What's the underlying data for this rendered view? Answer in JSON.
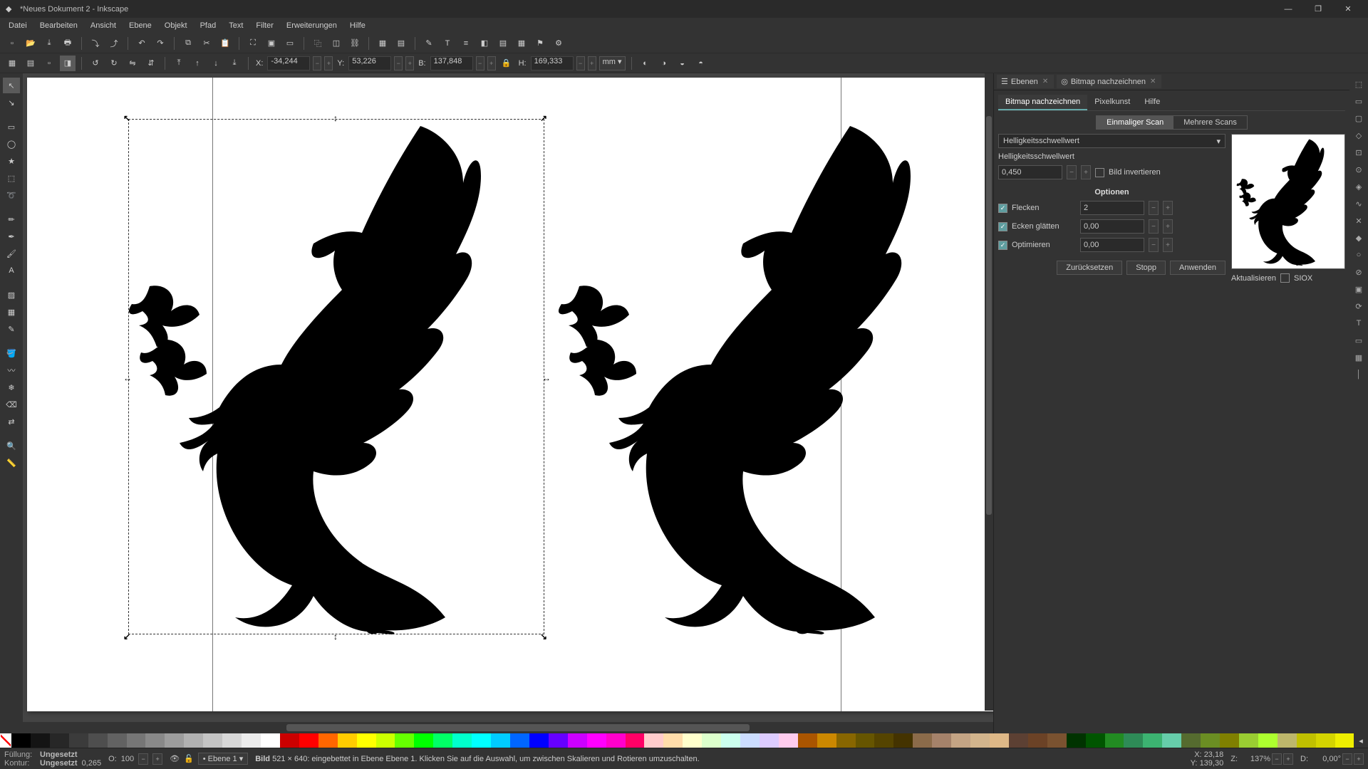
{
  "title": "*Neues Dokument 2 - Inkscape",
  "menu": [
    "Datei",
    "Bearbeiten",
    "Ansicht",
    "Ebene",
    "Objekt",
    "Pfad",
    "Text",
    "Filter",
    "Erweiterungen",
    "Hilfe"
  ],
  "toolbar2": {
    "x_label": "X:",
    "x_val": "-34,244",
    "y_label": "Y:",
    "y_val": "53,226",
    "w_label": "B:",
    "w_val": "137,848",
    "h_label": "H:",
    "h_val": "169,333",
    "unit": "mm"
  },
  "panel": {
    "tab_layers": "Ebenen",
    "tab_trace": "Bitmap nachzeichnen",
    "subtab_trace": "Bitmap nachzeichnen",
    "subtab_pixel": "Pixelkunst",
    "subtab_help": "Hilfe",
    "mode_single": "Einmaliger Scan",
    "mode_multi": "Mehrere Scans",
    "method": "Helligkeitsschwellwert",
    "threshold_label": "Helligkeitsschwellwert",
    "threshold_val": "0,450",
    "invert_label": "Bild invertieren",
    "options_title": "Optionen",
    "opt_speckles": "Flecken",
    "opt_speckles_val": "2",
    "opt_smooth": "Ecken glätten",
    "opt_smooth_val": "0,00",
    "opt_optimize": "Optimieren",
    "opt_optimize_val": "0,00",
    "btn_update": "Aktualisieren",
    "btn_siox": "SIOX",
    "btn_reset": "Zurücksetzen",
    "btn_stop": "Stopp",
    "btn_apply": "Anwenden"
  },
  "status": {
    "fill_label": "Füllung:",
    "fill_val": "Ungesetzt",
    "stroke_label": "Kontur:",
    "stroke_val": "Ungesetzt",
    "stroke_w": "0,265",
    "opacity_label": "O:",
    "opacity_val": "100",
    "layer": "Ebene 1",
    "msg_bold": "Bild",
    "msg_rest": " 521 × 640: eingebettet in Ebene Ebene 1. Klicken Sie auf die Auswahl, um zwischen Skalieren und Rotieren umzuschalten.",
    "x_label": "X:",
    "x_val": "23,18",
    "y_label": "Y:",
    "y_val": "139,30",
    "z_label": "Z:",
    "z_val": "137%",
    "d_label": "D:",
    "d_val": "0,00°"
  }
}
